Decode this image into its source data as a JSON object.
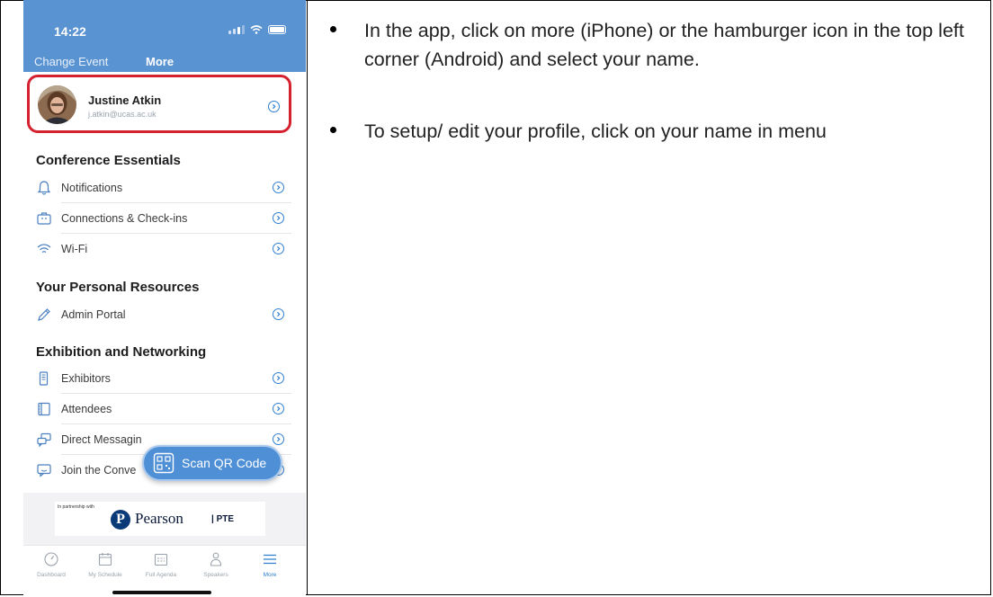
{
  "phone": {
    "status_time": "14:22",
    "header": {
      "change_event": "Change Event",
      "title": "More"
    },
    "profile": {
      "name": "Justine Atkin",
      "email": "j.atkin@ucas.ac.uk"
    },
    "sections": [
      {
        "title": "Conference Essentials",
        "items": [
          {
            "label": "Notifications",
            "icon": "bell-icon"
          },
          {
            "label": "Connections & Check-ins",
            "icon": "briefcase-icon"
          },
          {
            "label": "Wi-Fi",
            "icon": "wifi-icon"
          }
        ]
      },
      {
        "title": "Your Personal Resources",
        "items": [
          {
            "label": "Admin Portal",
            "icon": "pencil-icon"
          }
        ]
      },
      {
        "title": "Exhibition and Networking",
        "items": [
          {
            "label": "Exhibitors",
            "icon": "document-icon"
          },
          {
            "label": "Attendees",
            "icon": "book-icon"
          },
          {
            "label": "Direct Messagin",
            "icon": "chat-bubbles-icon"
          },
          {
            "label": "Join the Conve",
            "icon": "message-icon"
          }
        ]
      }
    ],
    "scan_button": {
      "label": "Scan QR Code",
      "icon": "qr-code-icon"
    },
    "sponsor": {
      "caption": "In partnership with",
      "logo_letter": "P",
      "name": "Pearson",
      "suffix": "| PTE"
    },
    "tabs": [
      {
        "label": "Dashboard",
        "icon": "gauge-icon"
      },
      {
        "label": "My Schedule",
        "icon": "calendar-icon"
      },
      {
        "label": "Full Agenda",
        "icon": "agenda-icon"
      },
      {
        "label": "Speakers",
        "icon": "person-icon"
      },
      {
        "label": "More",
        "icon": "hamburger-icon",
        "active": true
      }
    ],
    "colors": {
      "header": "#5a93d1",
      "accent": "#2f7fd0",
      "highlight": "#d5202f"
    }
  },
  "instructions": [
    "In the app, click on more (iPhone) or the hamburger icon in the top left corner (Android) and select your name.",
    "To setup/ edit your profile, click on your name in menu"
  ]
}
